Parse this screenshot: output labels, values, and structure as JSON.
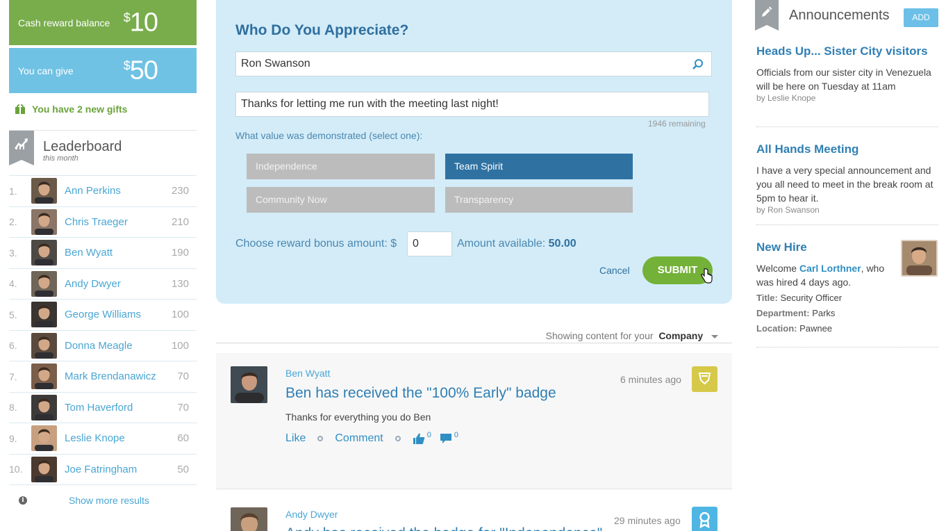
{
  "cash": {
    "label": "Cash reward balance",
    "currency": "$",
    "amount": "10"
  },
  "give": {
    "label": "You can give",
    "currency": "$",
    "amount": "50"
  },
  "gifts": {
    "text": "You have 2 new gifts"
  },
  "leaderboard": {
    "title": "Leaderboard",
    "subtitle": "this month",
    "rows": [
      {
        "rank": "1.",
        "name": "Ann Perkins",
        "score": "230"
      },
      {
        "rank": "2.",
        "name": "Chris Traeger",
        "score": "210"
      },
      {
        "rank": "3.",
        "name": "Ben Wyatt",
        "score": "190"
      },
      {
        "rank": "4.",
        "name": "Andy Dwyer",
        "score": "130"
      },
      {
        "rank": "5.",
        "name": "George Williams",
        "score": "100"
      },
      {
        "rank": "6.",
        "name": "Donna Meagle",
        "score": "100"
      },
      {
        "rank": "7.",
        "name": "Mark Brendanawicz",
        "score": "70"
      },
      {
        "rank": "8.",
        "name": "Tom Haverford",
        "score": "70"
      },
      {
        "rank": "9.",
        "name": "Leslie Knope",
        "score": "60"
      },
      {
        "rank": "10.",
        "name": "Joe Fatringham",
        "score": "50"
      }
    ],
    "show_more": "Show more results"
  },
  "appreciate": {
    "title": "Who Do You Appreciate?",
    "recipient_value": "Ron Swanson",
    "message_value": "Thanks for letting me run with the meeting last night!",
    "remaining": "1946 remaining",
    "value_question": "What value was demonstrated (select one):",
    "values": [
      {
        "label": "Independence",
        "selected": false
      },
      {
        "label": "Team Spirit",
        "selected": true
      },
      {
        "label": "Community Now",
        "selected": false
      },
      {
        "label": "Transparency",
        "selected": false
      }
    ],
    "bonus_label": "Choose reward bonus amount: $",
    "bonus_value": "0",
    "available_label": "Amount available: ",
    "available_value": "50.00",
    "cancel": "Cancel",
    "submit": "SUBMIT"
  },
  "filter": {
    "prefix": "Showing content for your",
    "value": "Company"
  },
  "feed": [
    {
      "author": "Ben Wyatt",
      "title": "Ben has received the \"100% Early\" badge",
      "body": "Thanks for everything you do Ben",
      "time": "6 minutes ago",
      "like": "Like",
      "comment": "Comment",
      "like_count": "0",
      "comment_count": "0",
      "badge_color": "#d6c94a"
    },
    {
      "author": "Andy Dwyer",
      "title": "Andy has received the badge for \"Independence\"",
      "time": "29 minutes ago",
      "badge_color": "#4fb6e3"
    }
  ],
  "announcements": {
    "title": "Announcements",
    "add": "ADD",
    "items": [
      {
        "heading": "Heads Up... Sister City visitors",
        "text": "Officials from our sister city in Venezuela will be here on Tuesday at 11am",
        "by": "by Leslie Knope"
      },
      {
        "heading": "All Hands Meeting",
        "text": "I have a very special announcement and you all need to meet in the break room at 5pm to hear it.",
        "by": "by Ron Swanson"
      }
    ],
    "new_hire": {
      "heading": "New Hire",
      "welcome": "Welcome ",
      "name": "Carl Lorthner",
      "rest": ", who was hired 4 days ago.",
      "title_label": "Title:",
      "title_value": " Security Officer",
      "dept_label": "Department:",
      "dept_value": " Parks",
      "loc_label": "Location:",
      "loc_value": " Pawnee"
    }
  },
  "colors": {
    "cash_green": "#79ad4c",
    "give_blue": "#70c2e4",
    "appreciate_bg": "#d3ecf8",
    "selected_value": "#2f72a2",
    "submit_green": "#73b138",
    "link_blue": "#4aa6d3"
  },
  "avatars": [
    "#6b5a48",
    "#8a7566",
    "#4d4a45",
    "#6f6558",
    "#3a3530",
    "#5a4a3e",
    "#7a5e4a",
    "#3d3a3a",
    "#c7a080",
    "#4a3a30"
  ]
}
